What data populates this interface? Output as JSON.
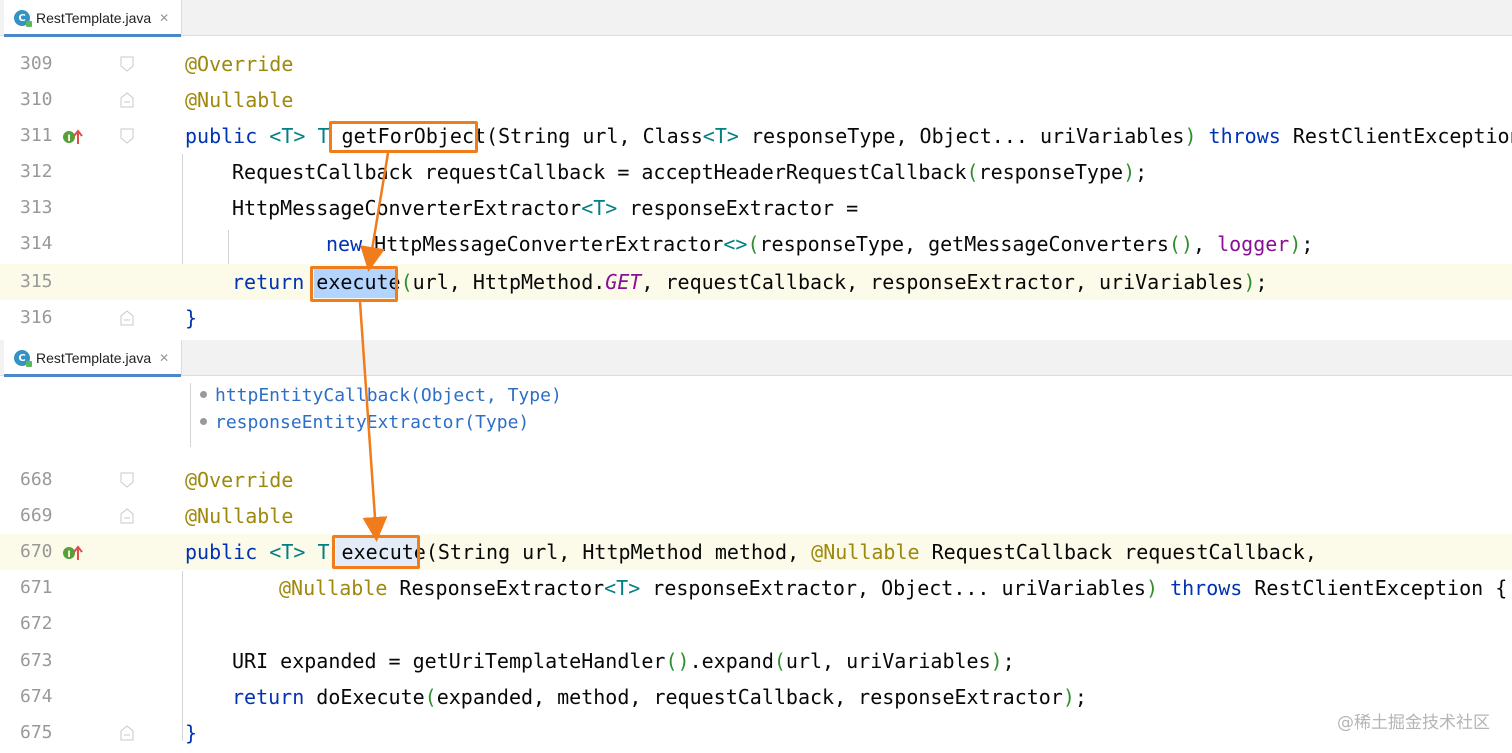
{
  "top_tab": {
    "label": "RestTemplate.java",
    "icon": "class-file-icon",
    "letter": "C"
  },
  "bottom_tab": {
    "label": "RestTemplate.java",
    "icon": "class-file-icon",
    "letter": "C"
  },
  "top_lines": [
    {
      "num": "309",
      "tokens": [
        "@Override"
      ]
    },
    {
      "num": "310",
      "tokens": [
        "@Nullable"
      ]
    },
    {
      "num": "311",
      "tokens": [
        "public",
        " ",
        "<T>",
        " T ",
        "getForObject",
        "(String url, Class",
        "<T>",
        " responseType, Object... uriVariables",
        ")",
        " ",
        "throws",
        " RestClientException {"
      ]
    },
    {
      "num": "312",
      "tokens": [
        "RequestCallback requestCallback = acceptHeaderRequestCallback",
        "(",
        "responseType",
        ")",
        ";"
      ]
    },
    {
      "num": "313",
      "tokens": [
        "HttpMessageConverterExtractor",
        "<T>",
        " responseExtractor ="
      ]
    },
    {
      "num": "314",
      "tokens": [
        "new",
        " HttpMessageConverterExtractor",
        "<>",
        "(",
        "responseType, getMessageConverters",
        "()",
        ", ",
        "logger",
        ")",
        ";"
      ]
    },
    {
      "num": "315",
      "tokens": [
        "return",
        " ",
        "execute",
        "(",
        "url, HttpMethod.",
        "GET",
        ", requestCallback, responseExtractor, uriVariables",
        ")",
        ";"
      ]
    },
    {
      "num": "316",
      "tokens": [
        "}"
      ]
    }
  ],
  "doc_items": [
    "httpEntityCallback(Object, Type)",
    "responseEntityExtractor(Type)"
  ],
  "bottom_lines": [
    {
      "num": "668",
      "tokens": [
        "@Override"
      ]
    },
    {
      "num": "669",
      "tokens": [
        "@Nullable"
      ]
    },
    {
      "num": "670",
      "tokens": [
        "public",
        " ",
        "<T>",
        " T ",
        "execute",
        "(String url, HttpMethod method, ",
        "@Nullable",
        " RequestCallback requestCallback,"
      ]
    },
    {
      "num": "671",
      "tokens": [
        "@Nullable",
        " ResponseExtractor",
        "<T>",
        " responseExtractor, Object... uriVariables",
        ")",
        " ",
        "throws",
        " RestClientException {"
      ]
    },
    {
      "num": "672",
      "tokens": [
        ""
      ]
    },
    {
      "num": "673",
      "tokens": [
        "URI expanded = getUriTemplateHandler",
        "()",
        ".expand",
        "(",
        "url, uriVariables",
        ")",
        ";"
      ]
    },
    {
      "num": "674",
      "tokens": [
        "return",
        " doExecute",
        "(",
        "expanded, method, requestCallback, responseExtractor",
        ")",
        ";"
      ]
    },
    {
      "num": "675",
      "tokens": [
        "}"
      ]
    }
  ],
  "watermark": "@稀土掘金技术社区",
  "colors": {
    "keyword": "#0033b3",
    "annotation": "#9e880d",
    "type_param": "#007f85",
    "field": "#871094",
    "highlight_box": "#f07c1b",
    "selection": "#b3d4ff",
    "current_line": "#fcfae8"
  }
}
